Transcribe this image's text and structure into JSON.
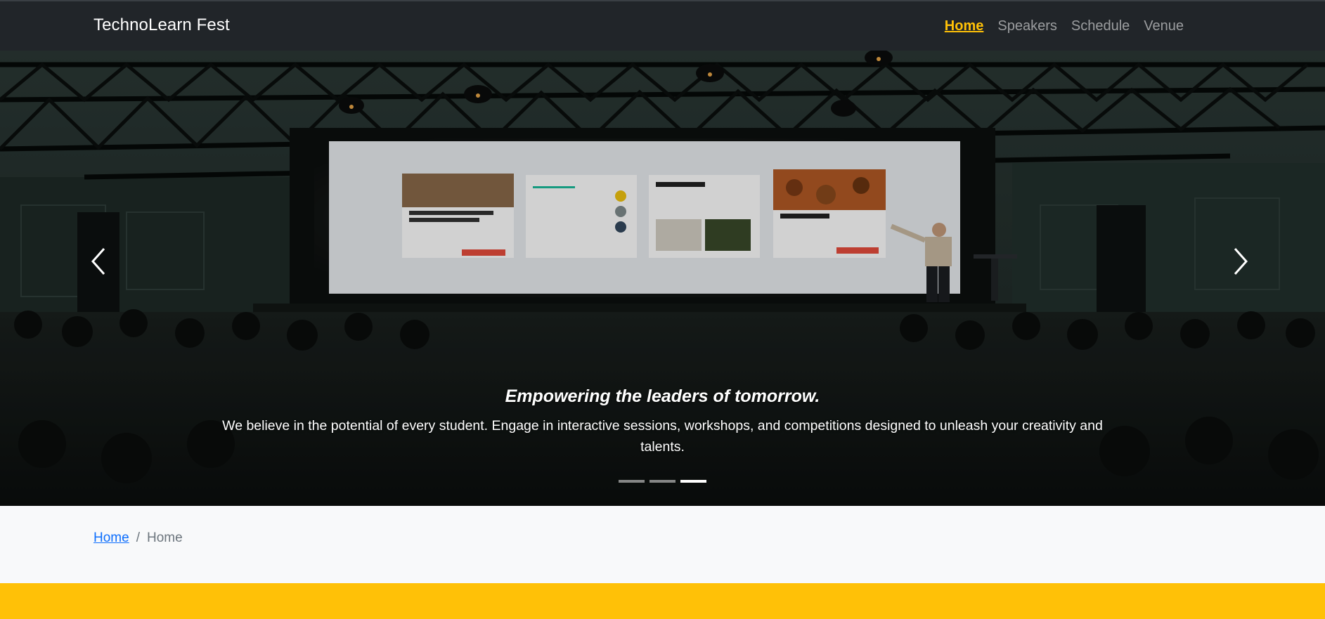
{
  "navbar": {
    "brand": "TechnoLearn Fest",
    "links": [
      "Home",
      "Speakers",
      "Schedule",
      "Venue"
    ],
    "active": "Home",
    "active_color": "#ffc107"
  },
  "hero": {
    "title": "Empowering the leaders of tomorrow.",
    "text": "We believe in the potential of every student. Engage in interactive sessions, workshops, and competitions designed to unleash your creativity and talents.",
    "indicator_count": 3,
    "active_indicator": 3,
    "prev_icon": "chevron-left-icon",
    "next_icon": "chevron-right-icon"
  },
  "breadcrumb": {
    "items": [
      "Home",
      "Home"
    ],
    "separator": "/"
  },
  "colors": {
    "navbar_bg": "#212529",
    "band": "#ffc107",
    "link": "#0d6efd"
  }
}
